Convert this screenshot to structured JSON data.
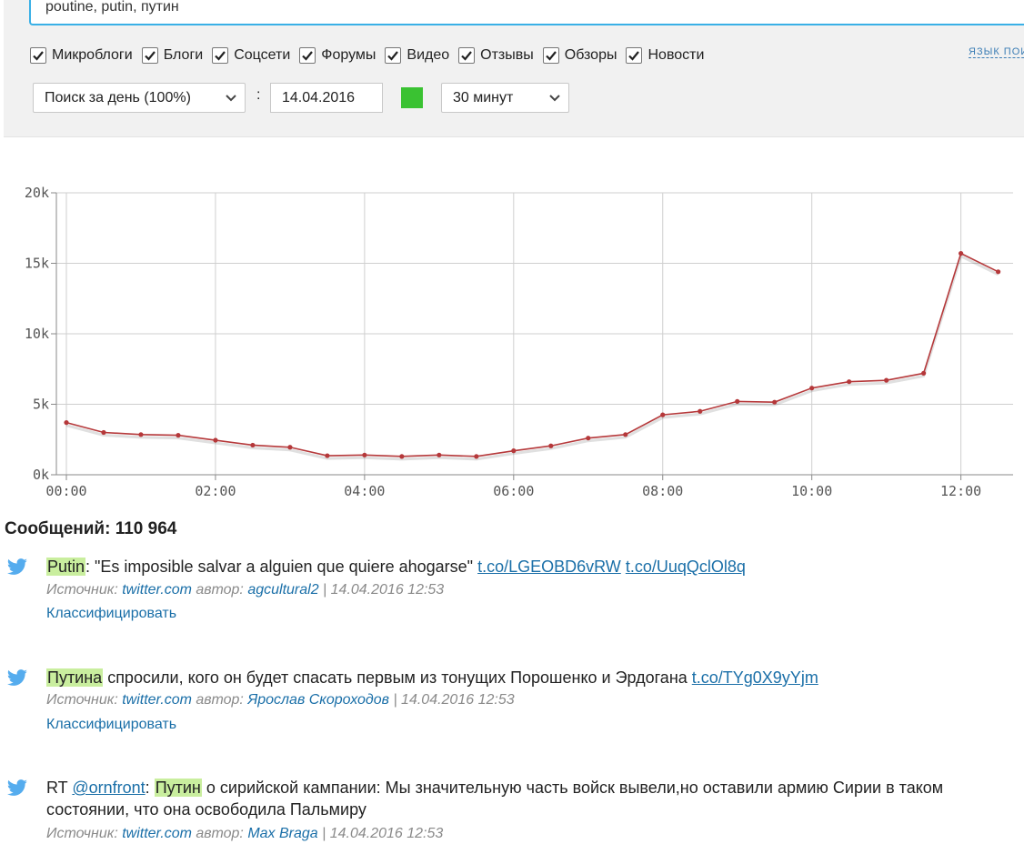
{
  "search": {
    "value": "poutine, putin, путин"
  },
  "filters": [
    {
      "label": "Микроблоги",
      "checked": true
    },
    {
      "label": "Блоги",
      "checked": true
    },
    {
      "label": "Соцсети",
      "checked": true
    },
    {
      "label": "Форумы",
      "checked": true
    },
    {
      "label": "Видео",
      "checked": true
    },
    {
      "label": "Отзывы",
      "checked": true
    },
    {
      "label": "Обзоры",
      "checked": true
    },
    {
      "label": "Новости",
      "checked": true
    }
  ],
  "language_link": "ЯЗЫК ПОИ",
  "controls": {
    "period_select": "Поиск за день (100%)",
    "colon": ":",
    "date": "14.04.2016",
    "swatch_color": "#3ac232",
    "interval_select": "30 минут"
  },
  "chart_data": {
    "type": "line",
    "x": [
      "00:00",
      "00:30",
      "01:00",
      "01:30",
      "02:00",
      "02:30",
      "03:00",
      "03:30",
      "04:00",
      "04:30",
      "05:00",
      "05:30",
      "06:00",
      "06:30",
      "07:00",
      "07:30",
      "08:00",
      "08:30",
      "09:00",
      "09:30",
      "10:00",
      "10:30",
      "11:00",
      "11:30",
      "12:00",
      "12:30"
    ],
    "xticks": [
      "00:00",
      "02:00",
      "04:00",
      "06:00",
      "08:00",
      "10:00",
      "12:00"
    ],
    "yticks": [
      "0k",
      "5k",
      "10k",
      "15k",
      "20k"
    ],
    "values": [
      3700,
      3000,
      2850,
      2800,
      2450,
      2100,
      1950,
      1350,
      1400,
      1300,
      1400,
      1300,
      1700,
      2050,
      2600,
      2850,
      4250,
      4500,
      5200,
      5150,
      6150,
      6600,
      6700,
      7200,
      15700,
      14400
    ],
    "ylim": [
      0,
      20000
    ],
    "grid": true,
    "line_color": "#b5383a",
    "title": "",
    "xlabel": "",
    "ylabel": ""
  },
  "results": {
    "total_label": "Сообщений: 110 964",
    "messages": [
      {
        "prefix": "",
        "mention": "",
        "sep": "",
        "highlight": "Putin",
        "text": ": \"Es imposible salvar a alguien que quiere ahogarse\" ",
        "links": [
          "t.co/LGEOBD6vRW",
          "t.co/UuqQclOl8q"
        ],
        "meta_source_label": "Источник: ",
        "source": "twitter.com",
        "meta_author_label": " автор: ",
        "author": "agcultural2",
        "meta_date": " | 14.04.2016 12:53",
        "classify": "Классифицировать"
      },
      {
        "prefix": "",
        "mention": "",
        "sep": "",
        "highlight": "Путина",
        "text": " спросили, кого он будет спасать первым из тонущих Порошенко и Эрдогана ",
        "links": [
          "t.co/TYg0X9yYjm"
        ],
        "meta_source_label": "Источник: ",
        "source": "twitter.com",
        "meta_author_label": " автор: ",
        "author": "Ярослав Скороходов",
        "meta_date": " | 14.04.2016 12:53",
        "classify": "Классифицировать"
      },
      {
        "prefix": "RT ",
        "mention": "@ornfront",
        "sep": ": ",
        "highlight": "Путин",
        "text": " о сирийской кампании: Мы значительную часть войск вывели,но оставили армию Сирии в таком состоянии, что она освободила Пальмиру",
        "links": [],
        "meta_source_label": "Источник: ",
        "source": "twitter.com",
        "meta_author_label": " автор: ",
        "author": "Max Braga",
        "meta_date": " | 14.04.2016 12:53",
        "classify": ""
      }
    ]
  },
  "icons": {
    "tweet": "twitter-bird-icon",
    "checkbox": "checkmark-icon",
    "dropdown": "chevron-down-icon"
  },
  "colors": {
    "accent": "#3ab0e6",
    "link": "#1a6fa8",
    "highlight": "#c9ee9e"
  }
}
